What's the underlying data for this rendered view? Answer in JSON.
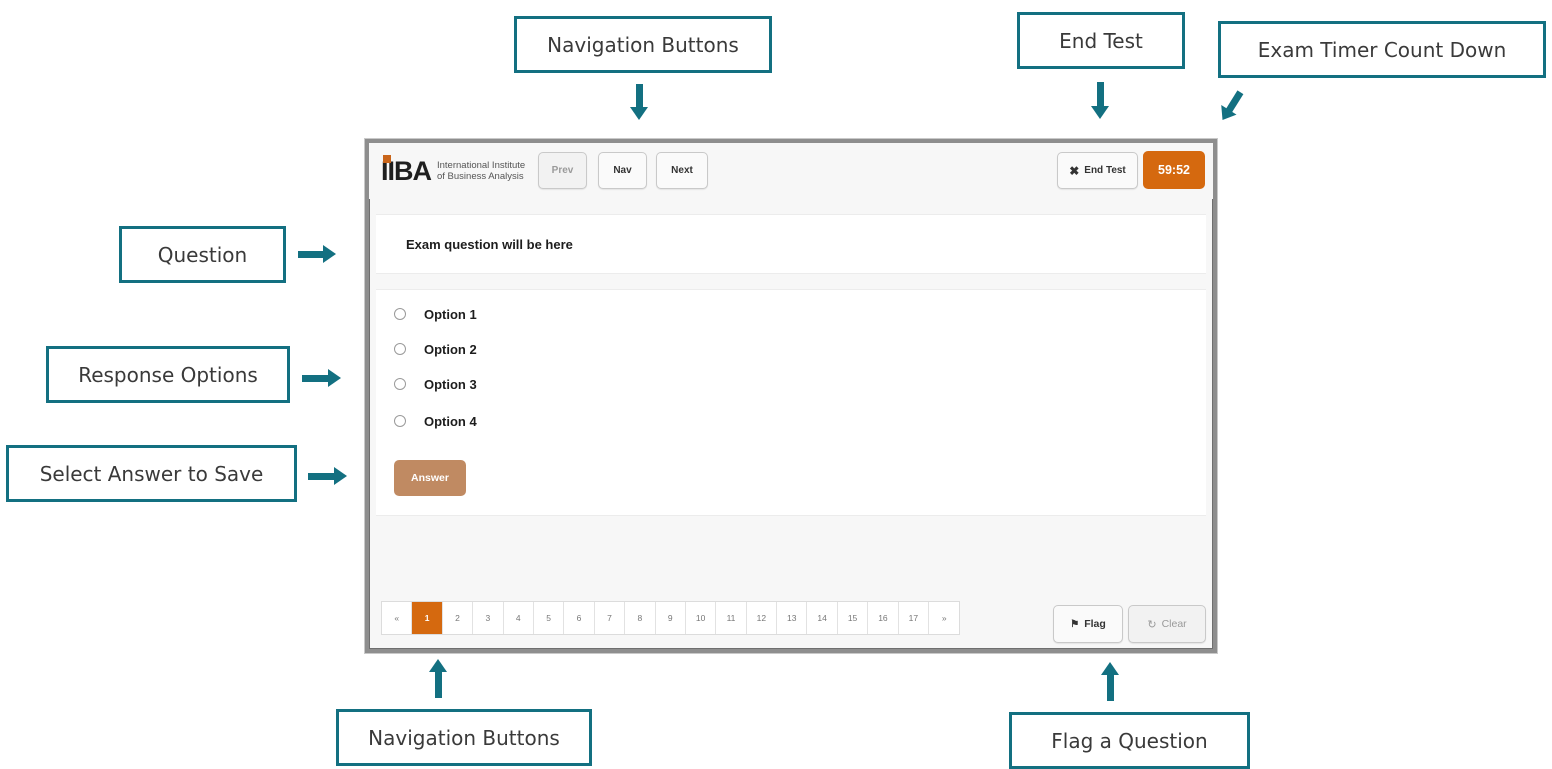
{
  "callouts": {
    "nav_top": "Navigation Buttons",
    "end_test": "End Test",
    "timer": "Exam Timer Count Down",
    "question": "Question",
    "response_options": "Response Options",
    "select_answer": "Select Answer to Save",
    "nav_bottom": "Navigation Buttons",
    "flag": "Flag a Question"
  },
  "app": {
    "logo": {
      "mark": "IIBA",
      "line1": "International Institute",
      "line2": "of Business Analysis"
    },
    "toolbar": {
      "prev": "Prev",
      "nav": "Nav",
      "next": "Next",
      "end_test": "End Test",
      "timer": "59:52"
    },
    "question_text": "Exam question will be here",
    "options": [
      "Option 1",
      "Option 2",
      "Option 3",
      "Option 4"
    ],
    "answer_button": "Answer",
    "pagination": [
      "«",
      "1",
      "2",
      "3",
      "4",
      "5",
      "6",
      "7",
      "8",
      "9",
      "10",
      "11",
      "12",
      "13",
      "14",
      "15",
      "16",
      "17",
      "»"
    ],
    "flag": "Flag",
    "clear": "Clear"
  },
  "colors": {
    "callout_border": "#137081",
    "accent_orange": "#d5690f",
    "answer_button": "#c08a62"
  }
}
